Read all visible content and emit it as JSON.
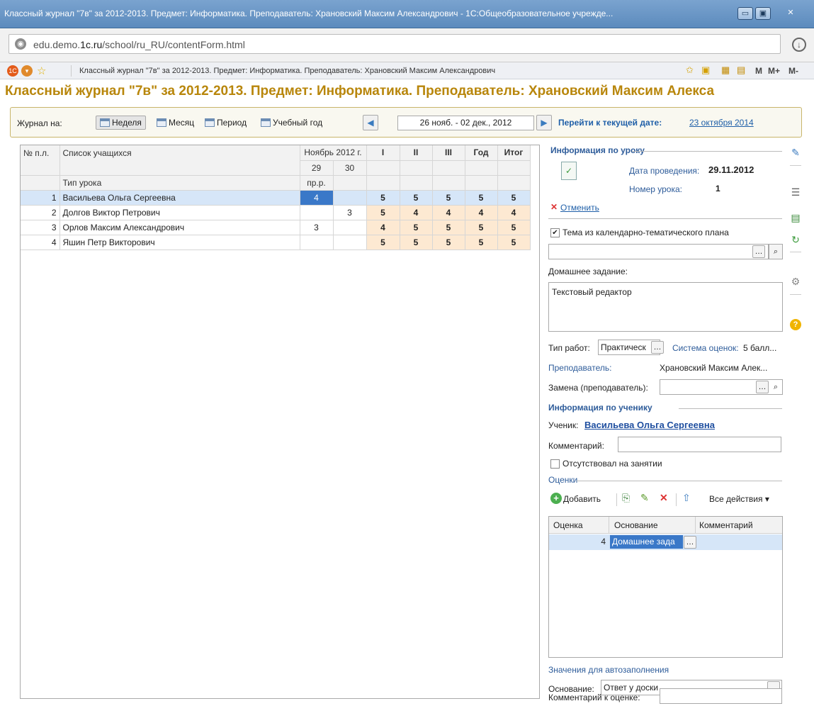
{
  "window": {
    "title": "Классный журнал \"7в\" за 2012-2013. Предмет: Информатика. Преподаватель: Храновский Максим Александрович - 1С:Общеобразовательное учрежде...",
    "btn_min": "▭",
    "btn_max": "▣",
    "btn_close": "✕"
  },
  "address": {
    "url_pre": "edu.demo.",
    "url_host": "1c.ru",
    "url_post": "/school/ru_RU/contentForm.html"
  },
  "bookmarks": {
    "title": "Классный журнал \"7в\" за 2012-2013. Предмет: Информатика. Преподаватель: Храновский Максим Александрович",
    "m": "M",
    "mplus": "M+",
    "mminus": "M-"
  },
  "page_title": "Классный журнал \"7в\" за 2012-2013. Предмет: Информатика. Преподаватель: Храновский Максим Алекса",
  "journal": {
    "label": "Журнал на:",
    "btn_week": "Неделя",
    "btn_month": "Месяц",
    "btn_period": "Период",
    "btn_year": "Учебный год",
    "date_range": "26 нояб. - 02 дек., 2012",
    "goto_label": "Перейти к текущей дате:",
    "goto_date": "23 октября 2014"
  },
  "grid": {
    "h_num": "№ п.л.",
    "h_list": "Список учащихся",
    "h_month": "Ноябрь 2012 г.",
    "h_q1": "I",
    "h_q2": "II",
    "h_q3": "III",
    "h_year": "Год",
    "h_final": "Итог",
    "day1": "29",
    "day2": "30",
    "lesson_type_label": "Тип урока",
    "lesson_type_d1": "пр.р.",
    "rows": [
      {
        "n": "1",
        "name": "Васильева Ольга Сергеевна",
        "d1": "4",
        "d2": "",
        "q1": "5",
        "q2": "5",
        "q3": "5",
        "year": "5",
        "final": "5"
      },
      {
        "n": "2",
        "name": "Долгов Виктор Петрович",
        "d1": "",
        "d2": "3",
        "q1": "5",
        "q2": "4",
        "q3": "4",
        "year": "4",
        "final": "4"
      },
      {
        "n": "3",
        "name": "Орлов Максим Александрович",
        "d1": "3",
        "d2": "",
        "q1": "4",
        "q2": "5",
        "q3": "5",
        "year": "5",
        "final": "5"
      },
      {
        "n": "4",
        "name": "Яшин Петр Викторович",
        "d1": "",
        "d2": "",
        "q1": "5",
        "q2": "5",
        "q3": "5",
        "year": "5",
        "final": "5"
      }
    ]
  },
  "lesson": {
    "section": "Информация по уроку",
    "date_label": "Дата проведения:",
    "date_value": "29.11.2012",
    "num_label": "Номер урока:",
    "num_value": "1",
    "cancel": "Отменить",
    "theme_check": "Тема из календарно-тематического плана",
    "theme_value": "",
    "homework_label": "Домашнее задание:",
    "homework_value": "Текстовый редактор",
    "worktype_label": "Тип работ:",
    "worktype_value": "Практическ",
    "system_label": "Система оценок:",
    "system_value": "5 балл...",
    "teacher_label": "Преподаватель:",
    "teacher_value": "Храновский Максим Алек...",
    "replace_label": "Замена (преподаватель):",
    "replace_value": ""
  },
  "student": {
    "section": "Информация по ученику",
    "student_label": "Ученик:",
    "student_name": "Васильева Ольга Сергеевна",
    "comment_label": "Комментарий:",
    "comment_value": "",
    "absent_label": "Отсутствовал на занятии"
  },
  "grades": {
    "section": "Оценки",
    "add": "Добавить",
    "all_actions": "Все действия",
    "col_grade": "Оценка",
    "col_basis": "Основание",
    "col_comment": "Комментарий",
    "rows": [
      {
        "grade": "4",
        "basis": "Домашнее зада",
        "comment": ""
      }
    ]
  },
  "autofill": {
    "section": "Значения для автозаполнения",
    "basis_label": "Основание:",
    "basis_value": "Ответ у доски",
    "comment_label": "Комментарий к оценке:",
    "comment_value": ""
  },
  "colors": {
    "title_gold": "#b8860b",
    "grade_bg": "#fde9d2",
    "selection": "#3a78c8",
    "link_blue": "#1f5fa8"
  }
}
